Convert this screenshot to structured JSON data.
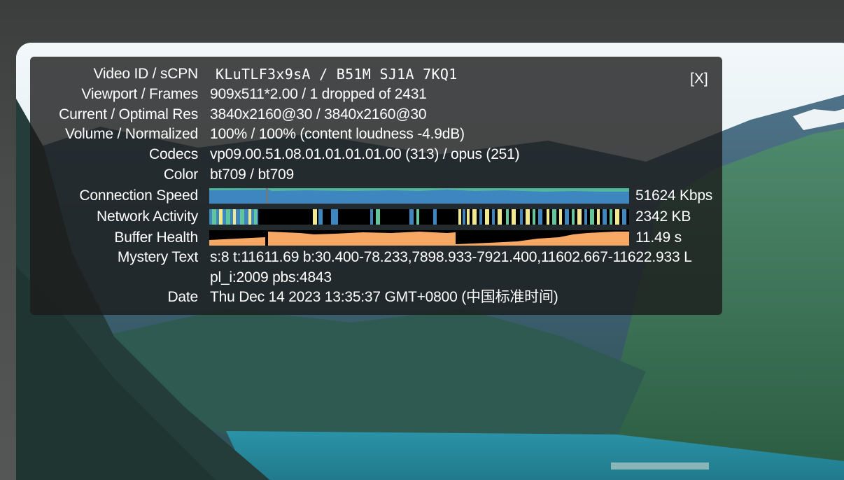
{
  "overlay": {
    "close_label": "[X]",
    "rows": {
      "video_id": {
        "label": "Video ID / sCPN",
        "value": "KLuTLF3x9sA / B51M SJ1A 7KQ1"
      },
      "viewport": {
        "label": "Viewport / Frames",
        "value": "909x511*2.00 / 1 dropped of 2431"
      },
      "resolution": {
        "label": "Current / Optimal Res",
        "value": "3840x2160@30 / 3840x2160@30"
      },
      "volume": {
        "label": "Volume / Normalized",
        "value": "100% / 100% (content loudness -4.9dB)"
      },
      "codecs": {
        "label": "Codecs",
        "value": "vp09.00.51.08.01.01.01.01.00 (313) / opus (251)"
      },
      "color": {
        "label": "Color",
        "value": "bt709 / bt709"
      },
      "connection": {
        "label": "Connection Speed",
        "value": "51624 Kbps"
      },
      "network": {
        "label": "Network Activity",
        "value": "2342 KB"
      },
      "buffer": {
        "label": "Buffer Health",
        "value": "11.49 s"
      },
      "mystery": {
        "label": "Mystery Text",
        "value_line1": "s:8 t:11611.69 b:30.400-78.233,7898.933-7921.400,11602.667-11622.933 L",
        "value_line2": "pl_i:2009 pbs:4843"
      },
      "date": {
        "label": "Date",
        "value": "Thu Dec 14 2023 13:35:37 GMT+0800 (中国标准时间)"
      }
    }
  },
  "colors": {
    "connection_fill": "#3d86c0",
    "connection_top": "#4fb89a",
    "network_dark": "#000000",
    "network_blue": "#3d86c0",
    "network_green": "#5fc79a",
    "network_yellow": "#f2e98c",
    "buffer_fill": "#f7a864",
    "buffer_dark": "#000000"
  }
}
